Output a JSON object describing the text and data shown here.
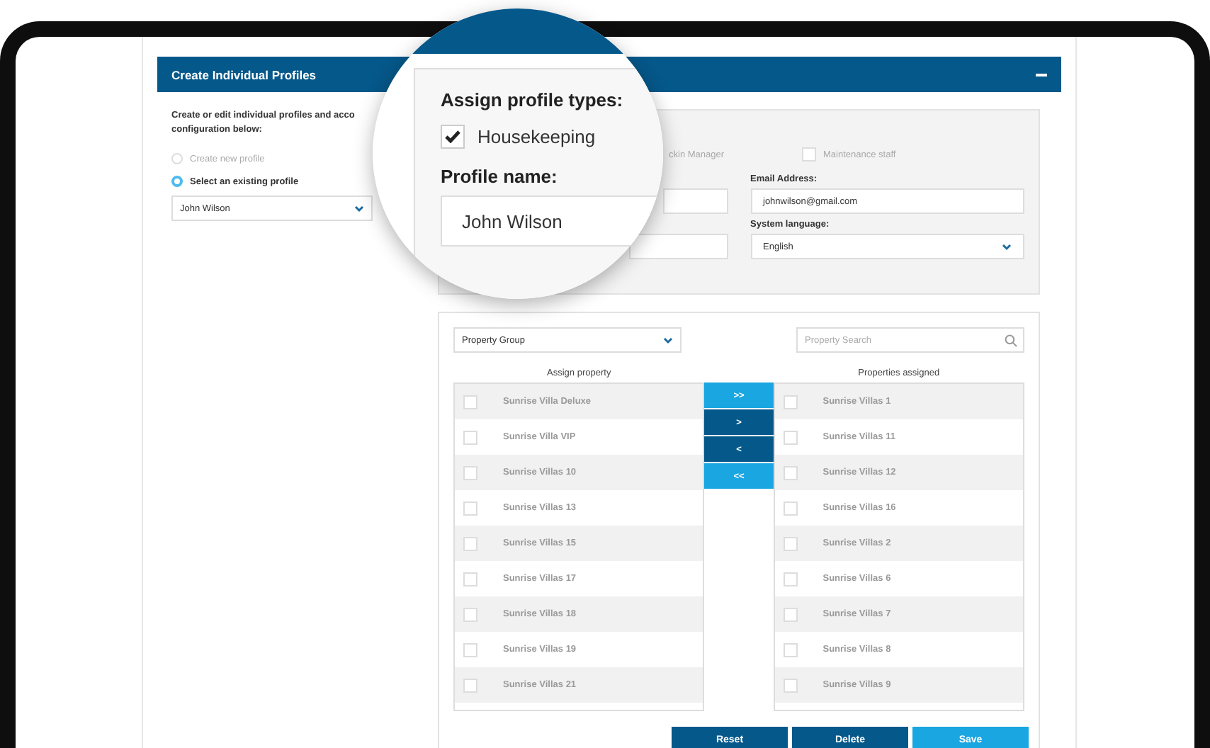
{
  "header": {
    "title": "Create Individual Profiles"
  },
  "intro_lines": [
    "Create or edit individual profiles and acco",
    "configuration below:"
  ],
  "profile_options": [
    {
      "label": "Create new profile",
      "selected": false
    },
    {
      "label": "Select an existing profile",
      "selected": true
    }
  ],
  "profile_select": {
    "value": "John Wilson"
  },
  "profile_types": [
    {
      "label": "ckin Manager"
    },
    {
      "label": "Maintenance staff",
      "checked": false
    }
  ],
  "fields": [
    {
      "label": "Email Address:",
      "value": "johnwilson@gmail.com",
      "kind": "text"
    },
    {
      "label": "System language:",
      "value": "English",
      "kind": "select"
    }
  ],
  "property_group": {
    "value": "Property Group"
  },
  "property_search": {
    "placeholder": "Property Search"
  },
  "assign_list": {
    "title": "Assign property",
    "items": [
      {
        "label": "Sunrise Villa Deluxe",
        "checked": false
      },
      {
        "label": "Sunrise Villa VIP",
        "checked": false
      },
      {
        "label": "Sunrise Villas 10",
        "checked": false
      },
      {
        "label": "Sunrise Villas 13",
        "checked": false
      },
      {
        "label": "Sunrise Villas 15",
        "checked": false
      },
      {
        "label": "Sunrise Villas 17",
        "checked": false
      },
      {
        "label": "Sunrise Villas 18",
        "checked": false
      },
      {
        "label": "Sunrise Villas 19",
        "checked": false
      },
      {
        "label": "Sunrise Villas 21",
        "checked": false
      }
    ]
  },
  "transfer_buttons": [
    {
      "label": ">>",
      "kind": "all"
    },
    {
      "label": ">",
      "kind": "one"
    },
    {
      "label": "<",
      "kind": "one"
    },
    {
      "label": "<<",
      "kind": "all"
    }
  ],
  "assigned_list": {
    "title": "Properties assigned",
    "items": [
      {
        "label": "Sunrise Villas 1",
        "checked": false
      },
      {
        "label": "Sunrise Villas 11",
        "checked": false
      },
      {
        "label": "Sunrise Villas 12",
        "checked": false
      },
      {
        "label": "Sunrise Villas 16",
        "checked": false
      },
      {
        "label": "Sunrise Villas 2",
        "checked": false
      },
      {
        "label": "Sunrise Villas 6",
        "checked": false
      },
      {
        "label": "Sunrise Villas 7",
        "checked": false
      },
      {
        "label": "Sunrise Villas 8",
        "checked": false
      },
      {
        "label": "Sunrise Villas 9",
        "checked": false
      }
    ]
  },
  "actions": [
    {
      "label": "Reset",
      "kind": "secondary"
    },
    {
      "label": "Delete",
      "kind": "secondary"
    },
    {
      "label": "Save",
      "kind": "primary"
    }
  ],
  "magnifier": {
    "title": "Assign profile types:",
    "type": {
      "label": "Housekeeping",
      "checked": true
    },
    "field_label": "Profile name:",
    "field_value": "John Wilson"
  }
}
